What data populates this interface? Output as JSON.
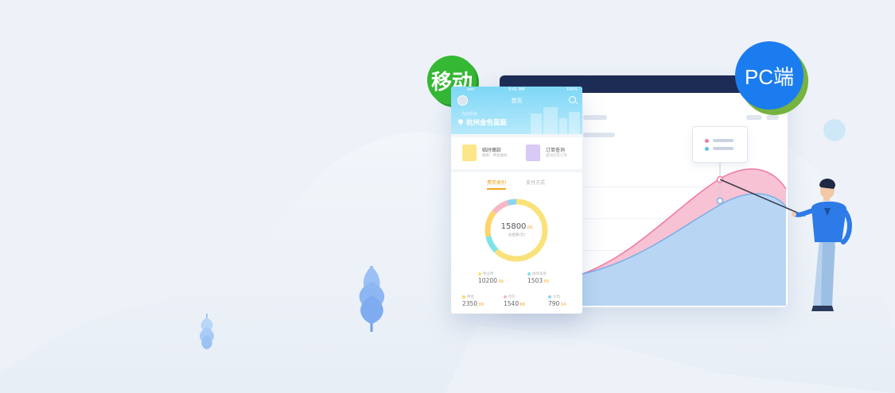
{
  "badges": {
    "mobile": "移动",
    "pc": "PC端"
  },
  "phone": {
    "status_left": "ooo",
    "status_time": "9:41 AM",
    "status_right": "100%",
    "title": "首页",
    "location_label": "当前项目",
    "location_name": "杭州金色蓝庭",
    "cards": [
      {
        "title": "临时缴款",
        "subtitle": "缴费、押金缴纳",
        "icon": "payment-card-icon"
      },
      {
        "title": "订单查询",
        "subtitle": "查询历史订单",
        "icon": "order-bag-icon"
      }
    ],
    "tabs": [
      "费用类别",
      "支付方式"
    ],
    "donut": {
      "total_integer": "15800",
      "total_decimal": ".00",
      "caption": "总金额(元)",
      "segments": [
        {
          "name": "物业费",
          "color": "#f9e27a",
          "value": 10200
        },
        {
          "name": "维修基金",
          "color": "#7fe3e6",
          "value": 1503.5
        },
        {
          "name": "押金",
          "color": "#ffd46b",
          "value": 2350
        },
        {
          "name": "停车",
          "color": "#f7b8c6",
          "value": 1540.66
        },
        {
          "name": "水电",
          "color": "#8ad5f2",
          "value": 790.14
        }
      ]
    },
    "stats_row1": [
      {
        "label": "物业费",
        "int": "10200",
        "dec": ".00",
        "color": "#f9e27a"
      },
      {
        "label": "维修基金",
        "int": "1503",
        "dec": ".50",
        "color": "#7fe3e6"
      }
    ],
    "stats_row2": [
      {
        "label": "押金",
        "int": "2350",
        "dec": ".00",
        "color": "#ffd46b"
      },
      {
        "label": "停车",
        "int": "1540",
        "dec": ".66",
        "color": "#f7b8c6"
      },
      {
        "label": "水电",
        "int": "790",
        "dec": ".14",
        "color": "#8ad5f2"
      }
    ]
  },
  "colors": {
    "pink": "#f4a6c2",
    "blue": "#a9cdef",
    "mobile_badge": "#35b833",
    "pc_badge": "#1b7cf0",
    "pc_topbar": "#1d2c54"
  }
}
